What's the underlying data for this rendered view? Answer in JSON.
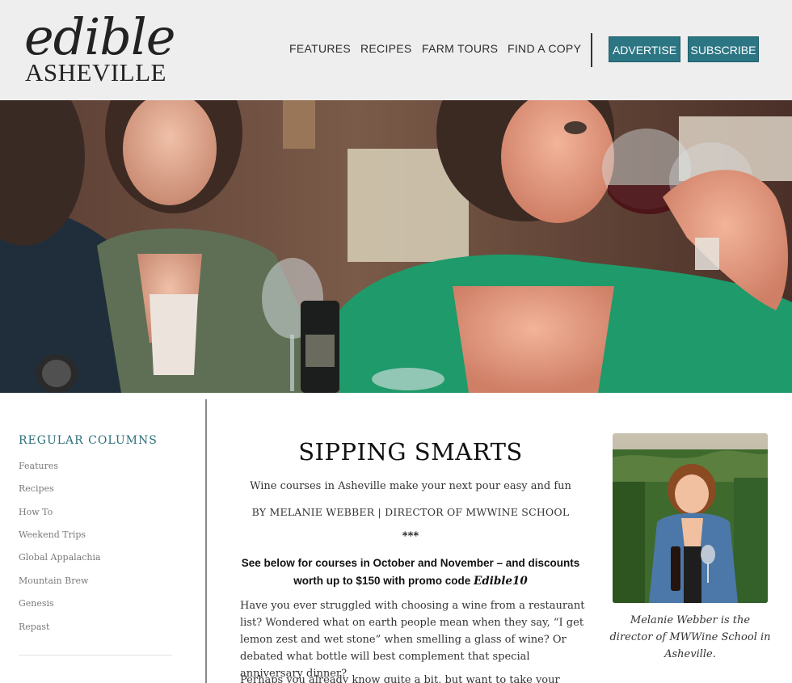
{
  "logo": {
    "top": "edible",
    "bottom": "ASHEVILLE"
  },
  "nav": {
    "items": [
      "FEATURES",
      "RECIPES",
      "FARM TOURS",
      "FIND A COPY"
    ],
    "advertise": "ADVERTISE",
    "subscribe": "SUBSCRIBE"
  },
  "sidebar": {
    "heading": "REGULAR COLUMNS",
    "items": [
      "Features",
      "Recipes",
      "How To",
      "Weekend Trips",
      "Global Appalachia",
      "Mountain Brew",
      "Genesis",
      "Repast"
    ]
  },
  "article": {
    "title": "SIPPING SMARTS",
    "subtitle": "Wine courses in Asheville make your next pour easy and fun",
    "byline": "BY MELANIE WEBBER | DIRECTOR OF MWWINE SCHOOL",
    "separator": "***",
    "promo_text": "See below for courses in October and November – and discounts worth up to $150 with promo code ",
    "promo_code": "Edible10",
    "paragraphs": [
      "Have you ever struggled with choosing a wine from a restaurant list? Wondered what on earth people mean when they say, “I get lemon zest and wet stone” when smelling a glass of wine? Or debated what bottle will best complement that special anniversary dinner?",
      "Perhaps you already know quite a bit, but want to take your knowledge"
    ]
  },
  "author": {
    "caption": "Melanie Webber is the director of MWWine School in Asheville."
  },
  "colors": {
    "header_bg": "#eeeeee",
    "accent_teal": "#2c7684",
    "sidebar_heading": "#2c6e7b"
  }
}
